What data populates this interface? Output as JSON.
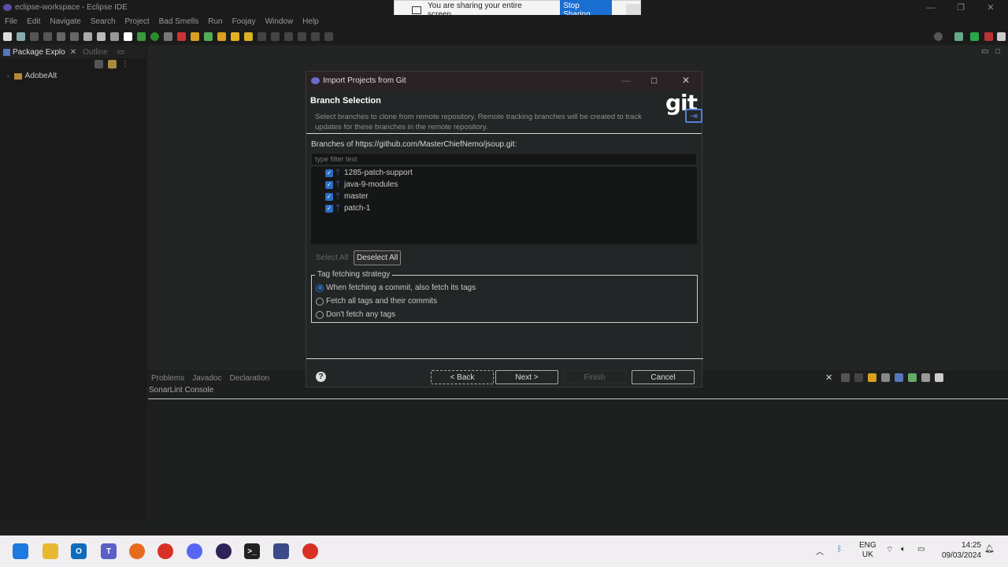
{
  "window": {
    "title": "eclipse-workspace - Eclipse IDE"
  },
  "sharebar": {
    "message": "You are sharing your entire screen.",
    "stop_label": "Stop Sharing",
    "hide_label": "_"
  },
  "menu": [
    "File",
    "Edit",
    "Navigate",
    "Search",
    "Project",
    "Bad Smells",
    "Run",
    "Foojay",
    "Window",
    "Help"
  ],
  "left_panel": {
    "tab_active": "Package Explo",
    "tab_inactive": "Outline",
    "tree_item": "AdobeAlt"
  },
  "bottom_panel": {
    "tabs": [
      "Problems",
      "Javadoc",
      "Declaration"
    ],
    "console_title": "SonarLint Console"
  },
  "dialog": {
    "title": "Import Projects from Git",
    "heading": "Branch Selection",
    "description": "Select branches to clone from remote repository. Remote tracking branches will be created to track updates for these branches in the remote repository.",
    "git_logo": "git",
    "branches_label": "Branches of https://github.com/MasterChiefNemo/jsoup.git:",
    "filter_placeholder": "type filter text",
    "branches": [
      "1285-patch-support",
      "java-9-modules",
      "master",
      "patch-1"
    ],
    "select_all": "Select All",
    "deselect_all": "Deselect All",
    "tag_strategy": {
      "legend": "Tag fetching strategy",
      "options": [
        "When fetching a commit, also fetch its tags",
        "Fetch all tags and their commits",
        "Don't fetch any tags"
      ],
      "selected_index": 0
    },
    "buttons": {
      "back": "< Back",
      "next": "Next >",
      "finish": "Finish",
      "cancel": "Cancel"
    }
  },
  "taskbar": {
    "lang_top": "ENG",
    "lang_bottom": "UK",
    "time": "14:25",
    "date": "09/03/2024"
  },
  "colors": {
    "accent": "#2b6cc4",
    "share_button": "#1b6ed1",
    "git_arrow": "#5580d8"
  }
}
